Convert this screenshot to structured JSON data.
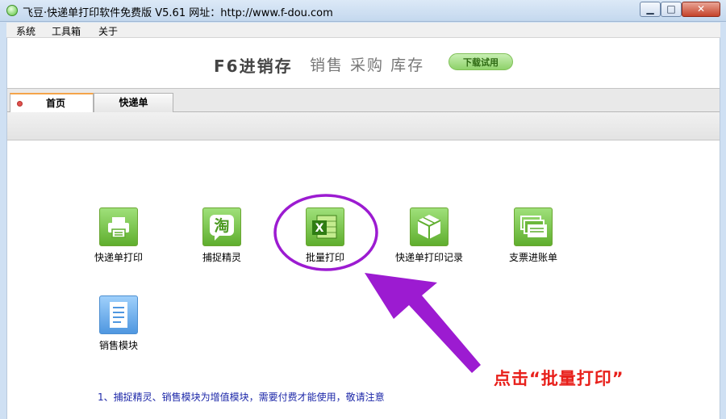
{
  "window": {
    "title": "飞豆·快递单打印软件免费版 V5.61 网址：http://www.f-dou.com",
    "minimize_label": "▁",
    "maximize_label": "□",
    "close_label": "✕"
  },
  "menu": {
    "items": [
      {
        "label": "系统"
      },
      {
        "label": "工具箱"
      },
      {
        "label": "关于"
      }
    ]
  },
  "banner": {
    "brand": "F6进销存",
    "tagline": "销售 采购 库存",
    "trial_button": "下载试用"
  },
  "tabs": [
    {
      "label": "首页",
      "active": true
    },
    {
      "label": "快递单",
      "active": false
    }
  ],
  "tiles": [
    {
      "label": "快递单打印",
      "icon": "printer-icon"
    },
    {
      "label": "捕捉精灵",
      "icon": "taobao-icon",
      "icon_text": "淘"
    },
    {
      "label": "批量打印",
      "icon": "excel-icon",
      "icon_text": "X"
    },
    {
      "label": "快递单打印记录",
      "icon": "box-icon"
    },
    {
      "label": "支票进账单",
      "icon": "cheque-icon"
    },
    {
      "label": "销售模块",
      "icon": "document-icon"
    }
  ],
  "notice": "1、捕捉精灵、销售模块为增值模块，需要付费才能使用，敬请注意",
  "annotation": "点击“批量打印”",
  "colors": {
    "annotation_red": "#e8201b",
    "arrow_purple": "#9c1bd1",
    "tile_green": "#5fae2e",
    "notice_blue": "#1c27a8"
  }
}
